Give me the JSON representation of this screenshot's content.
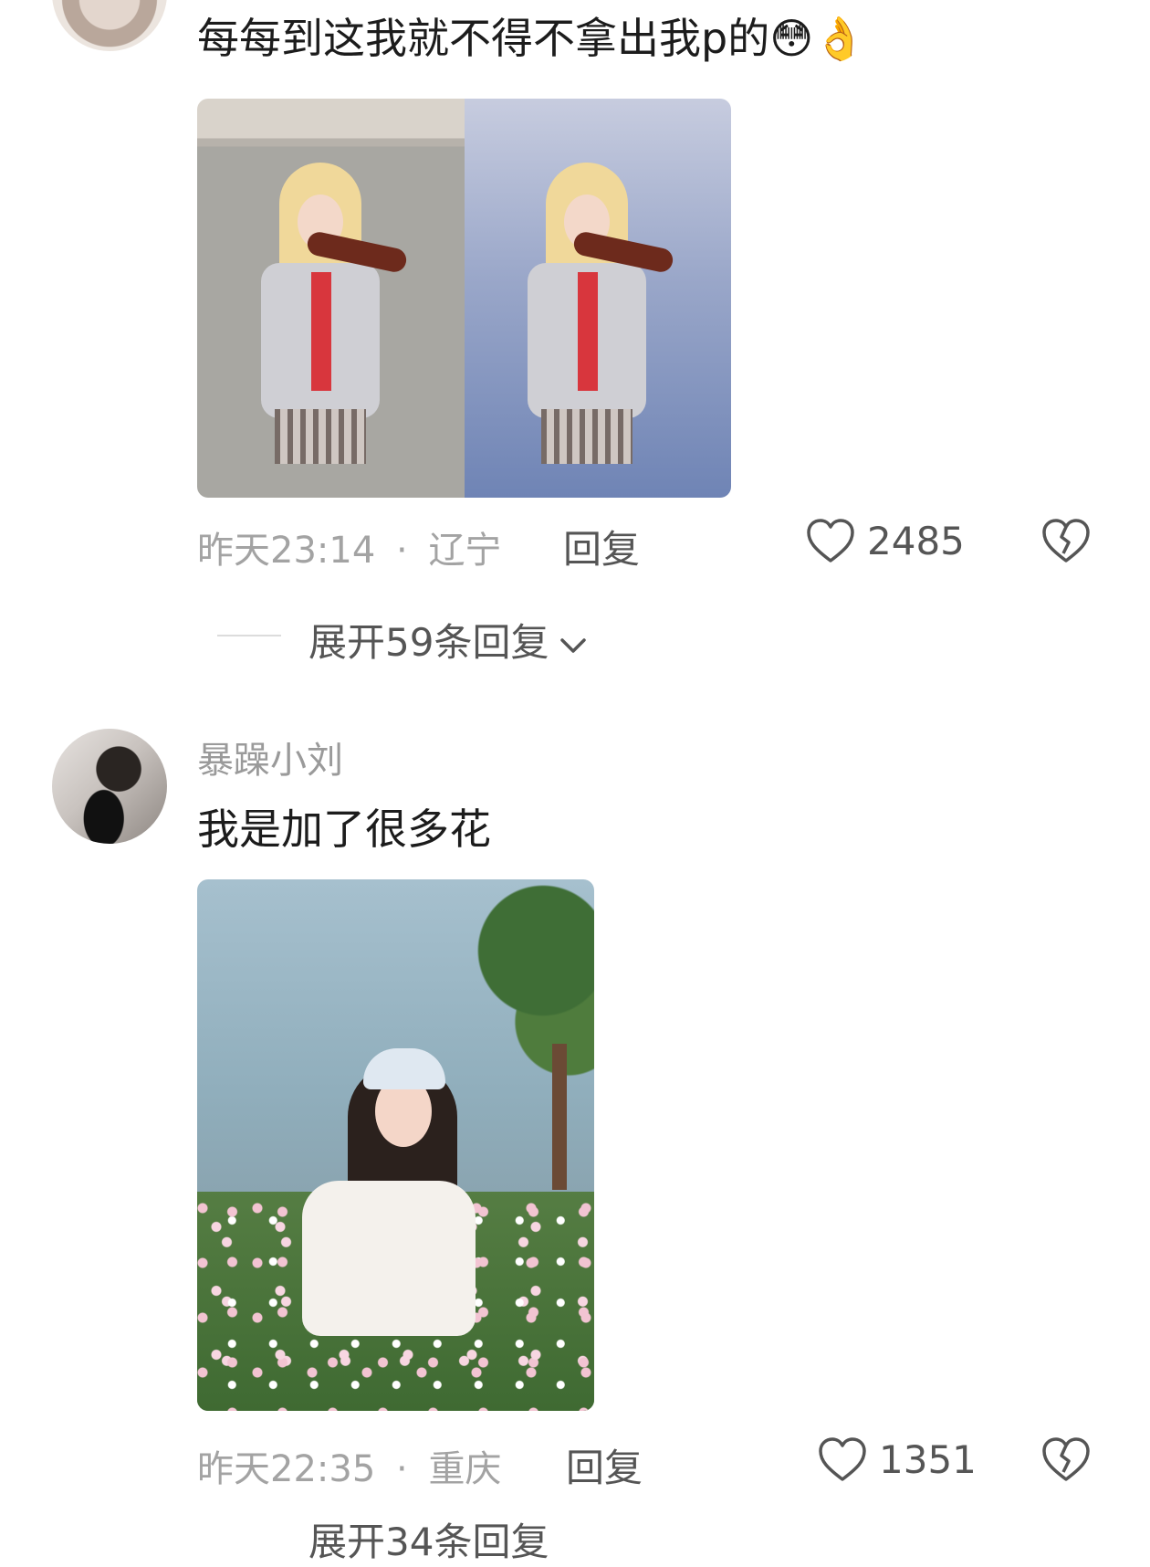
{
  "comments": [
    {
      "username": "",
      "text": "每每到这我就不得不拿出我p的",
      "emoji": [
        "😳",
        "👌"
      ],
      "time": "昨天23:14",
      "location": "辽宁",
      "reply_label": "回复",
      "like_count": "2485",
      "expand_replies": "展开59条回复"
    },
    {
      "username": "暴躁小刘",
      "text": "我是加了很多花",
      "time": "昨天22:35",
      "location": "重庆",
      "reply_label": "回复",
      "like_count": "1351",
      "expand_replies": "展开34条回复"
    }
  ],
  "separator": "·",
  "colors": {
    "meta_gray": "#a3a3a3",
    "text_dark": "#1c1c1c",
    "icon_gray": "#555555"
  },
  "icons": [
    "heart-outline-icon",
    "broken-heart-icon",
    "chevron-down-icon"
  ]
}
